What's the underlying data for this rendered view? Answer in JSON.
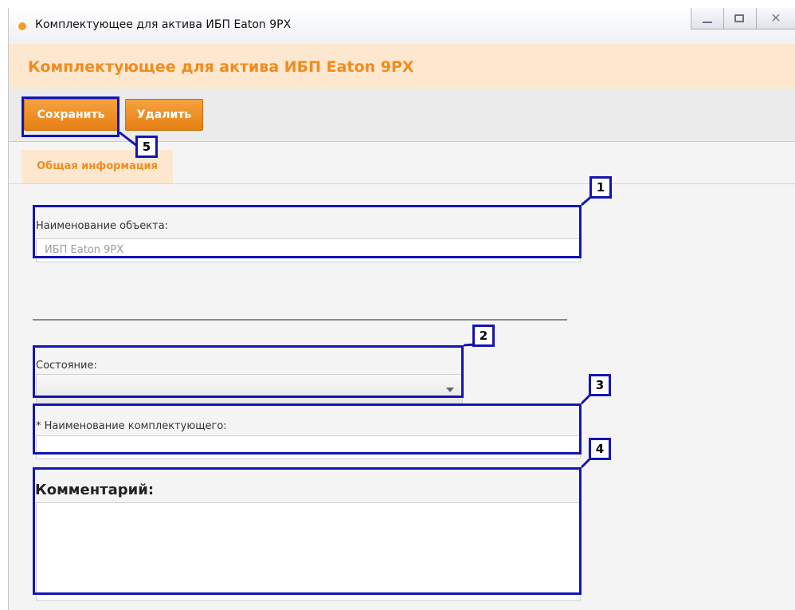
{
  "window": {
    "title": "Комплектующее для актива ИБП Eaton 9PX",
    "close_glyph": "✕",
    "controls": [
      "minimize-icon",
      "maximize-icon",
      "close-icon"
    ]
  },
  "header": {
    "title": "Комплектующее для актива ИБП Eaton 9PX"
  },
  "toolbar": {
    "save_label": "Сохранить",
    "delete_label": "Удалить"
  },
  "tabs": [
    {
      "label": "Общая информация",
      "active": true
    }
  ],
  "form": {
    "object_name_label": "Наименование объекта:",
    "object_name_value": "ИБП Eaton 9PX",
    "state_label": "Состояние:",
    "state_value": "",
    "component_name_label": "* Наименование комплектующего:",
    "component_name_value": "",
    "comment_label": "Комментарий:",
    "comment_value": ""
  },
  "annotations": [
    "1",
    "2",
    "3",
    "4",
    "5"
  ],
  "colors": {
    "accent": "#f08c1e",
    "header_bg": "#fde7cf",
    "annotation": "#1414b4"
  }
}
